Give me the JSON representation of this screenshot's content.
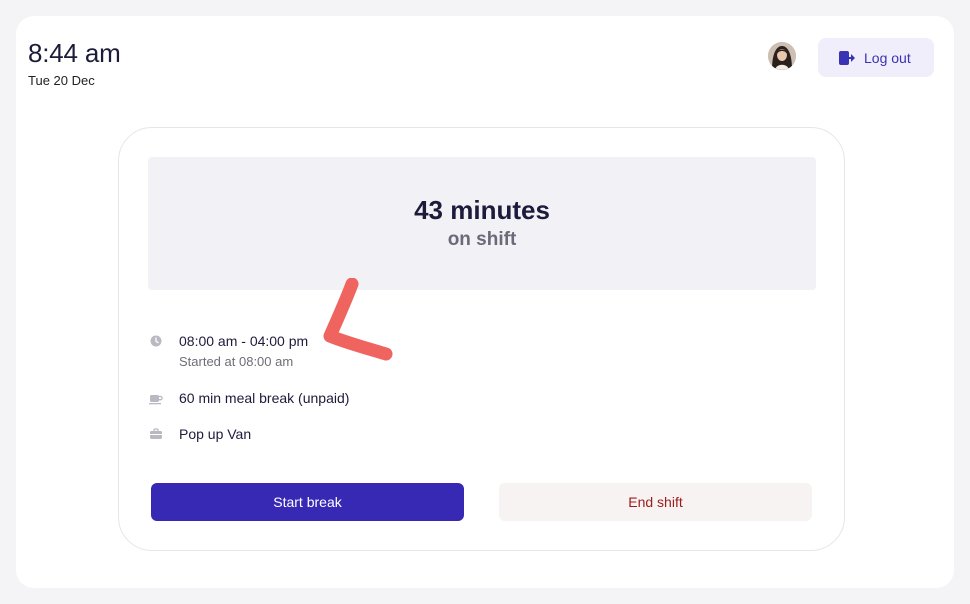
{
  "header": {
    "time": "8:44 am",
    "date": "Tue 20 Dec",
    "logout_label": "Log out"
  },
  "shift": {
    "duration": "43 minutes",
    "status": "on shift",
    "hours": "08:00 am - 04:00 pm",
    "started": "Started at 08:00 am",
    "meal_break": "60 min meal break (unpaid)",
    "location": "Pop up Van"
  },
  "actions": {
    "start_break": "Start break",
    "end_shift": "End shift"
  },
  "colors": {
    "primary": "#3829b5",
    "danger_text": "#9b1c1c",
    "annotation": "#f0645f"
  },
  "icons": [
    "clock-icon",
    "coffee-icon",
    "briefcase-icon",
    "logout-icon",
    "avatar"
  ]
}
